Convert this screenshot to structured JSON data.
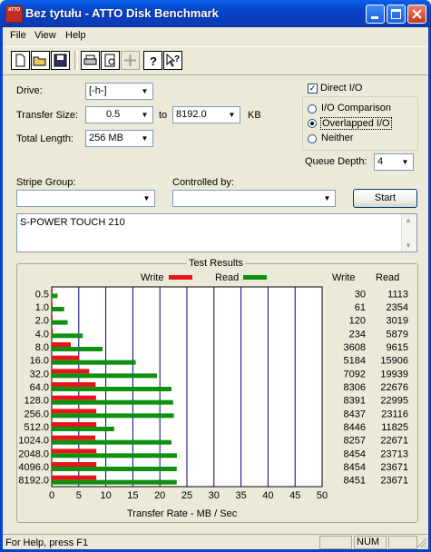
{
  "window": {
    "title": "Bez tytułu - ATTO Disk Benchmark",
    "icon_text": "ATTO"
  },
  "menu": [
    "File",
    "View",
    "Help"
  ],
  "toolbar_icons": [
    "new-document-icon",
    "open-folder-icon",
    "save-icon",
    "print-icon",
    "print-preview-icon",
    "move-icon",
    "help-icon",
    "context-help-icon"
  ],
  "form": {
    "drive_label": "Drive:",
    "drive_value": "[-h-]",
    "transfer_size_label": "Transfer Size:",
    "transfer_from": "0.5",
    "to_label": "to",
    "transfer_to": "8192.0",
    "kb_label": "KB",
    "total_length_label": "Total Length:",
    "total_length_value": "256 MB",
    "direct_io_label": "Direct I/O",
    "direct_io_checked": true,
    "io_modes": [
      "I/O Comparison",
      "Overlapped I/O",
      "Neither"
    ],
    "io_selected": "Overlapped I/O",
    "queue_depth_label": "Queue Depth:",
    "queue_depth_value": "4",
    "stripe_group_label": "Stripe Group:",
    "controlled_by_label": "Controlled by:",
    "start_label": "Start",
    "description": "S-POWER TOUCH 210"
  },
  "results": {
    "title": "Test Results",
    "write_legend": "Write",
    "read_legend": "Read",
    "write_col": "Write",
    "read_col": "Read",
    "xlabel": "Transfer Rate - MB / Sec"
  },
  "chart_data": {
    "type": "bar",
    "title": "Test Results",
    "xlabel": "Transfer Rate - MB / Sec",
    "xlim": [
      0,
      50
    ],
    "xticks": [
      0,
      5,
      10,
      15,
      20,
      25,
      30,
      35,
      40,
      45,
      50
    ],
    "categories": [
      "0.5",
      "1.0",
      "2.0",
      "4.0",
      "8.0",
      "16.0",
      "32.0",
      "64.0",
      "128.0",
      "256.0",
      "512.0",
      "1024.0",
      "2048.0",
      "4096.0",
      "8192.0"
    ],
    "series": [
      {
        "name": "Write",
        "color": "#E8141C",
        "values": [
          30,
          61,
          120,
          234,
          3608,
          5184,
          7092,
          8306,
          8391,
          8437,
          8446,
          8257,
          8454,
          8454,
          8451
        ]
      },
      {
        "name": "Read",
        "color": "#109010",
        "values": [
          1113,
          2354,
          3019,
          5879,
          9615,
          15906,
          19939,
          22676,
          22995,
          23116,
          11825,
          22671,
          23713,
          23671,
          23671
        ]
      }
    ],
    "value_units": "KB/s",
    "grid": true
  },
  "statusbar": {
    "help": "For Help, press F1",
    "num": "NUM"
  }
}
